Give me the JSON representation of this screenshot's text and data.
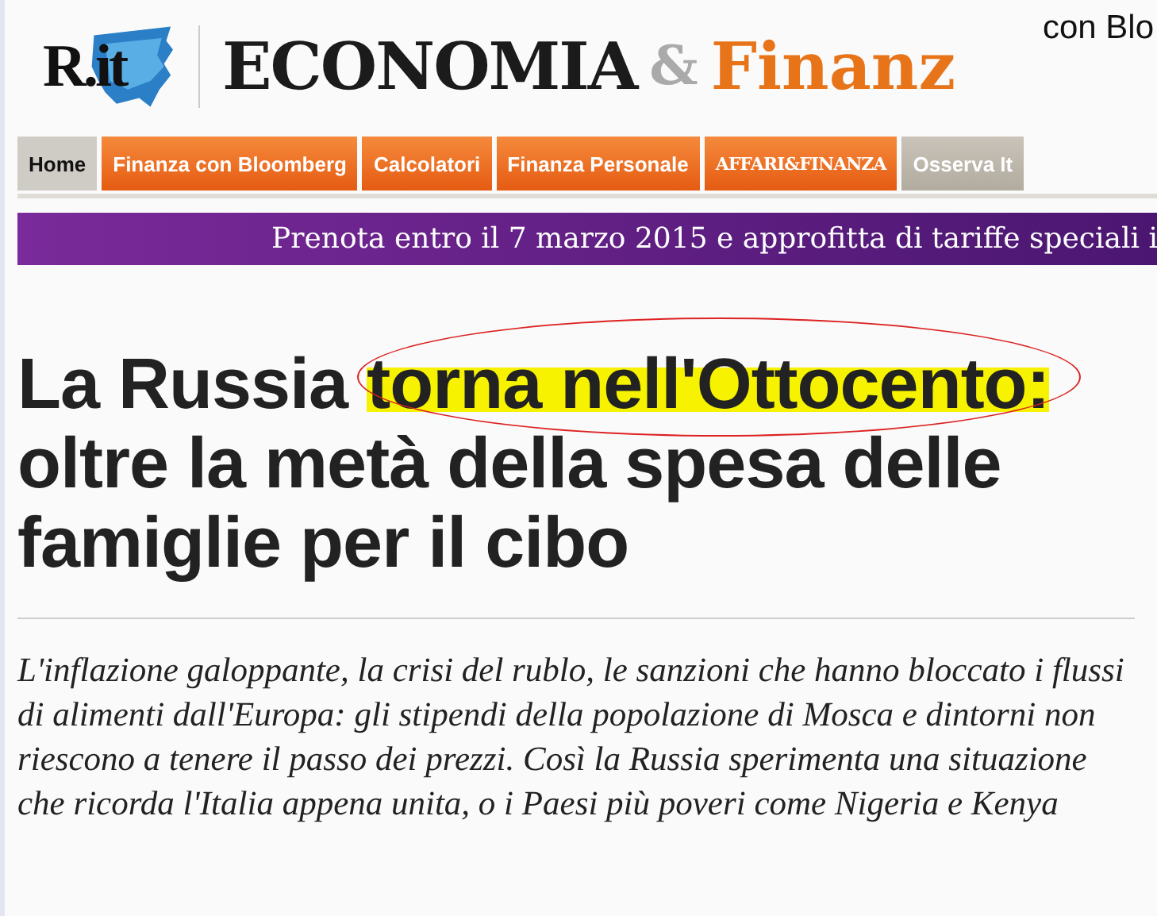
{
  "header": {
    "logo": "R.it",
    "title": "ECONOMIA",
    "ampersand": "&",
    "title_2": "Finanz",
    "tagline": "con Blo"
  },
  "nav": [
    {
      "label": "Home",
      "kind": "plain",
      "selected": true
    },
    {
      "label": "Finanza con Bloomberg",
      "kind": "orange",
      "selected": false
    },
    {
      "label": "Calcolatori",
      "kind": "orange",
      "selected": false
    },
    {
      "label": "Finanza Personale",
      "kind": "orange",
      "selected": false
    },
    {
      "label": "AFFARI&FINANZA",
      "kind": "brand",
      "selected": false
    },
    {
      "label": "Osserva It",
      "kind": "grey",
      "selected": false
    }
  ],
  "banner": "Prenota entro il 7 marzo 2015 e approfitta di tariffe speciali i",
  "headline": {
    "before": "La Russia",
    "marked": "torna nell'Ottocento:",
    "after": "oltre la metà della spesa delle famiglie per il cibo"
  },
  "lede": "L'inflazione galoppante, la crisi del rublo, le sanzioni che hanno bloccato i flussi di alimenti dall'Europa: gli stipendi della popolazione di Mosca e dintorni non riescono a tenere il passo dei prezzi. Così la Russia sperimenta una situazione che ricorda l'Italia appena unita, o i Paesi più poveri come Nigeria e Kenya"
}
